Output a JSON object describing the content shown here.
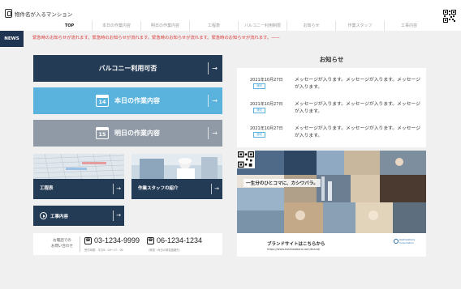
{
  "header": {
    "site_title": "物件名が入るマンション",
    "nav": [
      {
        "label": "TOP"
      },
      {
        "label": "本日の作業内容"
      },
      {
        "label": "明日の作業内容"
      },
      {
        "label": "工程表"
      },
      {
        "label": "バルコニー利用制限"
      },
      {
        "label": "お知らせ"
      },
      {
        "label": "作業スタッフ"
      },
      {
        "label": "工事内容"
      }
    ]
  },
  "news": {
    "label": "NEWS",
    "text": "緊急時のお知らせが流れます。緊急時のお知らせが流れます。緊急時のお知らせが流れます。緊急時のお知らせが流れます。——"
  },
  "menu": {
    "balcony": {
      "label": "バルコニー利用可否",
      "arrow": "→"
    },
    "today": {
      "label": "本日の作業内容",
      "day": "14",
      "arrow": "→"
    },
    "tomorrow": {
      "label": "明日の作業内容",
      "day": "15",
      "arrow": "→"
    },
    "schedule": {
      "label": "工程表",
      "arrow": "→"
    },
    "staff": {
      "label": "作業スタッフの紹介",
      "arrow": "→"
    },
    "work": {
      "label": "工事内容",
      "arrow": "→"
    }
  },
  "contact": {
    "label_line1": "お電話での",
    "label_line2": "お問い合わせ",
    "tel1": "03-1234-9999",
    "tel1_note": "受付時間：平日8：00〜17：00",
    "tel2": "06-1234-1234",
    "tel2_note": "（夜間・休日の緊急連絡先）"
  },
  "notices": {
    "title": "お知らせ",
    "items": [
      {
        "date": "2021年10月27日",
        "badge": "通知",
        "message": "メッセージが入ります。メッセージが入ります。メッセージが入ります。"
      },
      {
        "date": "2021年10月27日",
        "badge": "通知",
        "message": "メッセージが入ります。メッセージが入ります。メッセージが入ります。"
      },
      {
        "date": "2021年10月27日",
        "badge": "通知",
        "message": "メッセージが入ります。メッセージが入ります。メッセージが入ります。"
      }
    ]
  },
  "recruit": {
    "catch_copy": "一生分のひとコマに、カシワバラ。",
    "link_label": "ブランドサイトはこちらから",
    "url": "https://www.kashiwabara.com/brand/",
    "brand": "Kashiwabara Corporation"
  },
  "colors": {
    "navy": "#243b55",
    "sky": "#5ab3dd",
    "gray": "#8f9aa6",
    "news_red": "#d83a3a"
  }
}
